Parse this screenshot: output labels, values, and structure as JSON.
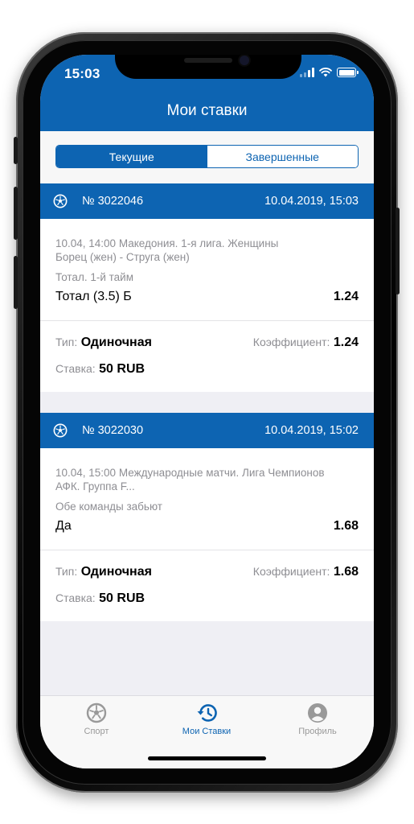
{
  "status_bar": {
    "time": "15:03"
  },
  "header": {
    "title": "Мои ставки"
  },
  "segments": {
    "current": "Текущие",
    "finished": "Завершенные"
  },
  "bets": [
    {
      "number": "№ 3022046",
      "datetime": "10.04.2019, 15:03",
      "event_line1": "10.04, 14:00 Македония. 1-я лига. Женщины",
      "event_line2": "Борец (жен) - Струга (жен)",
      "market": "Тотал. 1-й тайм",
      "outcome": "Тотал (3.5) Б",
      "outcome_odd": "1.24",
      "type_label": "Тип:",
      "type_value": "Одиночная",
      "coef_label": "Коэффициент:",
      "coef_value": "1.24",
      "stake_label": "Ставка:",
      "stake_value": "50 RUB"
    },
    {
      "number": "№ 3022030",
      "datetime": "10.04.2019, 15:02",
      "event_line1": "10.04, 15:00 Международные матчи. Лига Чемпионов",
      "event_line2": "АФК. Группа F...",
      "market": "Обе команды забьют",
      "outcome": "Да",
      "outcome_odd": "1.68",
      "type_label": "Тип:",
      "type_value": "Одиночная",
      "coef_label": "Коэффициент:",
      "coef_value": "1.68",
      "stake_label": "Ставка:",
      "stake_value": "50 RUB"
    }
  ],
  "tabbar": {
    "sport": "Спорт",
    "my_bets": "Мои Ставки",
    "profile": "Профиль"
  },
  "colors": {
    "brand": "#0d64b2",
    "inactive_tab": "#999999"
  }
}
